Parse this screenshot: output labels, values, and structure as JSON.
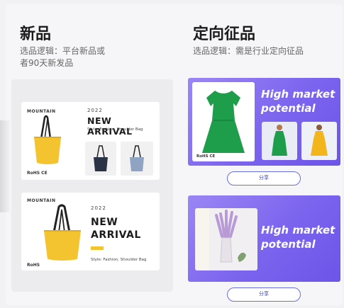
{
  "new_products": {
    "title": "新品",
    "desc_line1": "选品逻辑：平台新品或",
    "desc_line2": "者90天新发品",
    "card1": {
      "brand": "MOUNTAIN",
      "year": "2022",
      "headline": "NEW ARRIVAL",
      "style": "Style: Fashion, Shoulder Bag",
      "cert": "RoHS  CE"
    },
    "card2": {
      "brand": "MOUNTAIN",
      "year": "2022",
      "headline_line1": "NEW",
      "headline_line2": "ARRIVAL",
      "style": "Style: Fashion, Shoulder Bag",
      "cert": "RoHS"
    }
  },
  "targeted_products": {
    "title": "定向征品",
    "desc": "选品逻辑：需是行业定向征品",
    "card1": {
      "headline_line1": "High market",
      "headline_line2": "potential",
      "cert": "RoHS  CE",
      "share_label": "分享"
    },
    "card2": {
      "headline_line1": "High market",
      "headline_line2": "potential",
      "share_label": "分享"
    }
  },
  "colors": {
    "accent_purple": "#7b64ee",
    "share_border": "#6a6fe0",
    "bag_yellow": "#f4c430",
    "dress_green": "#1e9e4a"
  }
}
